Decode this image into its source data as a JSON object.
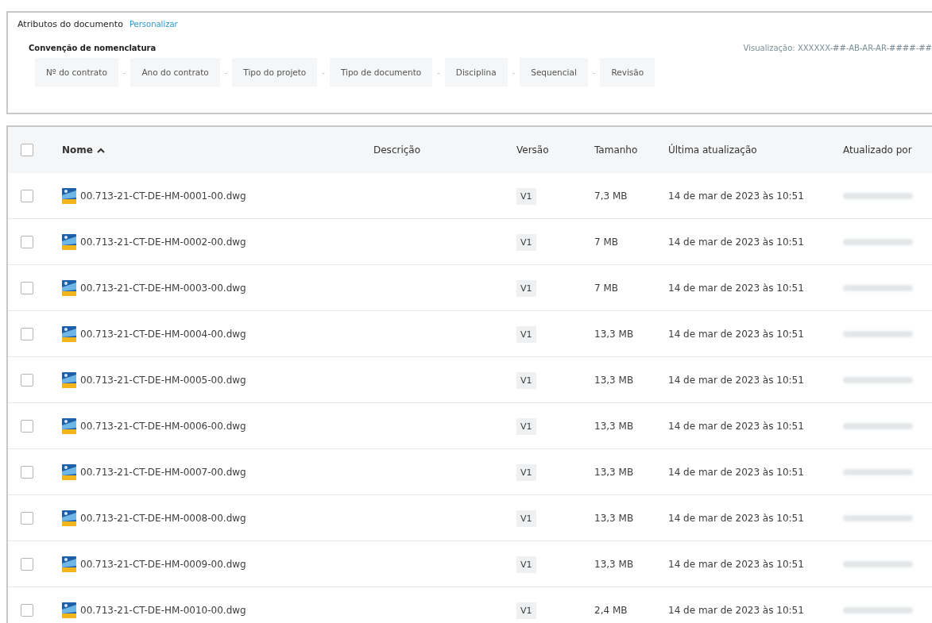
{
  "attributes": {
    "title": "Atributos do documento",
    "customize_link": "Personalizar",
    "naming_label": "Convenção de nomenclatura",
    "preview": "Visualização: XXXXXX-##-AB-AR-AR-####-##",
    "separator": "-",
    "segments": [
      "Nº do contrato",
      "Ano do contrato",
      "Tipo do projeto",
      "Tipo de documento",
      "Disciplina",
      "Sequencial",
      "Revisão"
    ]
  },
  "table": {
    "columns": [
      {
        "label": "Nome",
        "sorted_ascending": true
      },
      {
        "label": "Descrição"
      },
      {
        "label": "Versão"
      },
      {
        "label": "Tamanho"
      },
      {
        "label": "Última atualização"
      },
      {
        "label": "Atualizado por"
      }
    ],
    "select_all_checked": false,
    "rows": [
      {
        "name": "00.713-21-CT-DE-HM-0001-00.dwg",
        "version": "V1",
        "size": "7,3 MB",
        "updated": "14 de mar de 2023 às 10:51",
        "checked": false
      },
      {
        "name": "00.713-21-CT-DE-HM-0002-00.dwg",
        "version": "V1",
        "size": "7 MB",
        "updated": "14 de mar de 2023 às 10:51",
        "checked": false
      },
      {
        "name": "00.713-21-CT-DE-HM-0003-00.dwg",
        "version": "V1",
        "size": "7 MB",
        "updated": "14 de mar de 2023 às 10:51",
        "checked": false
      },
      {
        "name": "00.713-21-CT-DE-HM-0004-00.dwg",
        "version": "V1",
        "size": "13,3 MB",
        "updated": "14 de mar de 2023 às 10:51",
        "checked": false
      },
      {
        "name": "00.713-21-CT-DE-HM-0005-00.dwg",
        "version": "V1",
        "size": "13,3 MB",
        "updated": "14 de mar de 2023 às 10:51",
        "checked": false
      },
      {
        "name": "00.713-21-CT-DE-HM-0006-00.dwg",
        "version": "V1",
        "size": "13,3 MB",
        "updated": "14 de mar de 2023 às 10:51",
        "checked": false
      },
      {
        "name": "00.713-21-CT-DE-HM-0007-00.dwg",
        "version": "V1",
        "size": "13,3 MB",
        "updated": "14 de mar de 2023 às 10:51",
        "checked": false
      },
      {
        "name": "00.713-21-CT-DE-HM-0008-00.dwg",
        "version": "V1",
        "size": "13,3 MB",
        "updated": "14 de mar de 2023 às 10:51",
        "checked": false
      },
      {
        "name": "00.713-21-CT-DE-HM-0009-00.dwg",
        "version": "V1",
        "size": "13,3 MB",
        "updated": "14 de mar de 2023 às 10:51",
        "checked": false
      },
      {
        "name": "00.713-21-CT-DE-HM-0010-00.dwg",
        "version": "V1",
        "size": "2,4 MB",
        "updated": "14 de mar de 2023 às 10:51",
        "checked": false
      }
    ]
  }
}
